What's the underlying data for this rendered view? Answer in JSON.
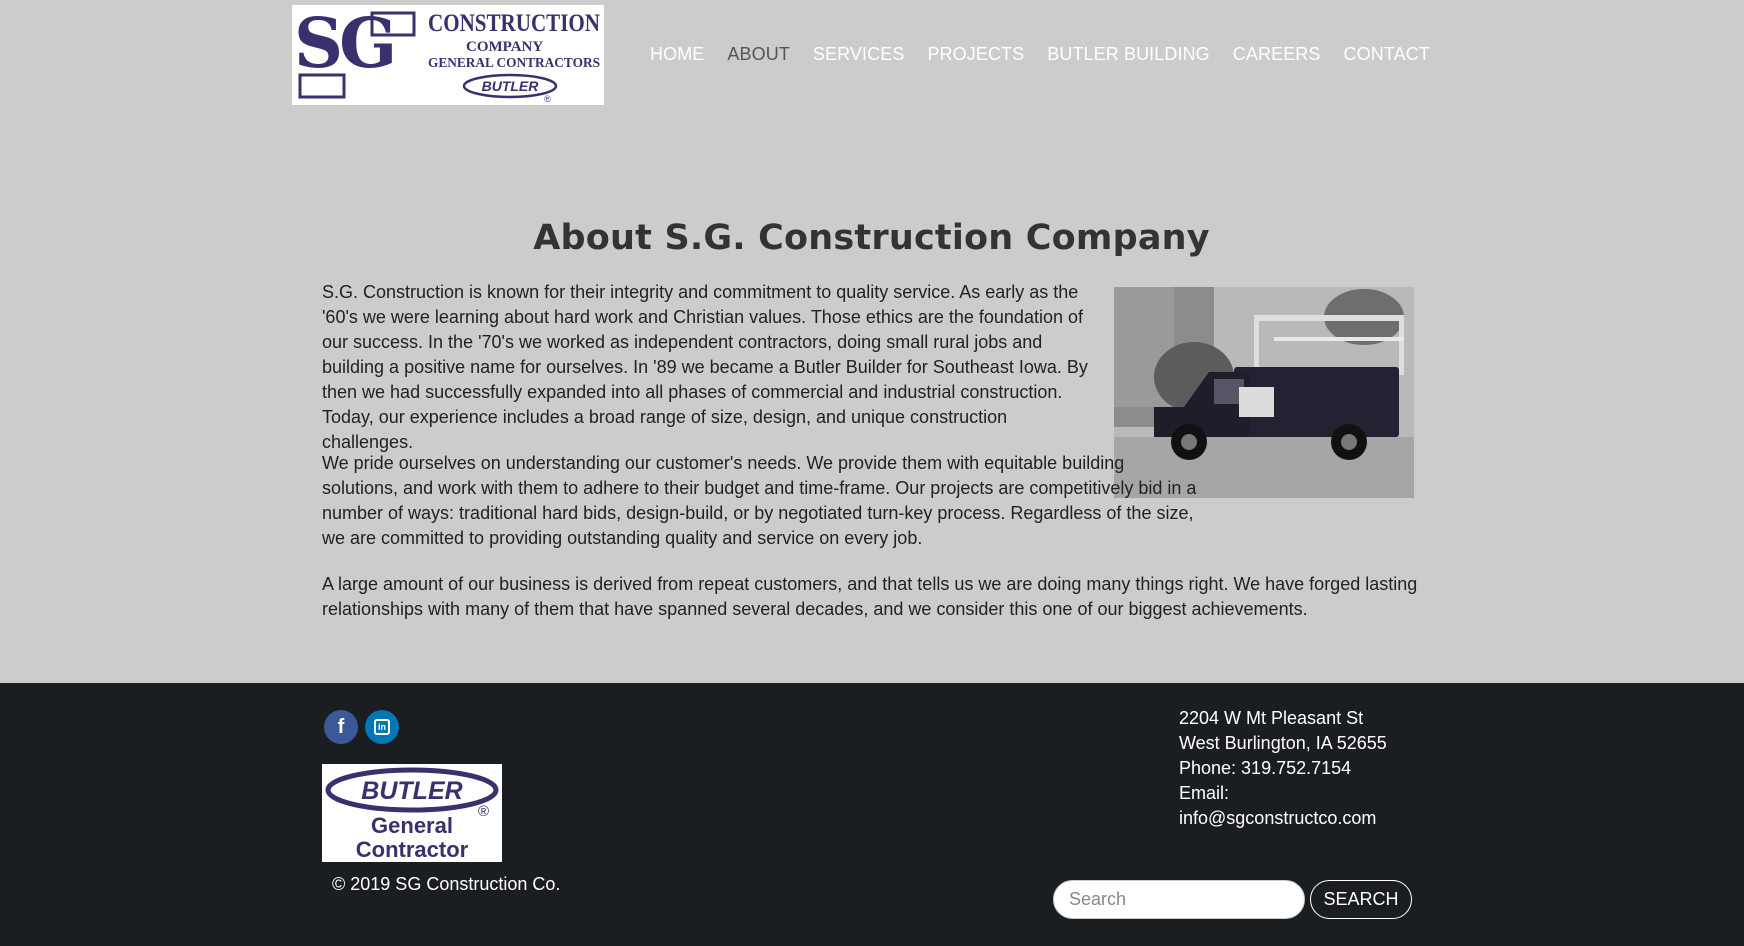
{
  "header": {
    "logo": {
      "alt": "SG Construction Company General Contractors Butler",
      "letters": "SG",
      "line1": "CONSTRUCTION",
      "line2": "COMPANY",
      "line3": "GENERAL CONTRACTORS",
      "badge": "BUTLER",
      "registered": "®",
      "color": "#3b2f6e"
    },
    "nav": [
      {
        "label": "HOME",
        "active": false
      },
      {
        "label": "ABOUT",
        "active": true
      },
      {
        "label": "SERVICES",
        "active": false
      },
      {
        "label": "PROJECTS",
        "active": false
      },
      {
        "label": "BUTLER BUILDING",
        "active": false
      },
      {
        "label": "CAREERS",
        "active": false
      },
      {
        "label": "CONTACT",
        "active": false
      }
    ]
  },
  "main": {
    "title": "About S.G. Construction Company",
    "paragraphs": [
      "S.G. Construction is known for their integrity and commitment to quality service. As early as the '60's we were learning about hard work and Christian values. Those ethics are the foundation of our success. In the '70's we worked as independent contractors, doing small rural jobs and building a positive name for ourselves. In '89 we became a Butler Builder for Southeast Iowa. By then we had successfully expanded into all phases of commercial and industrial construction. Today, our experience includes a broad range of size, design, and unique construction challenges.",
      "We pride ourselves on understanding our customer's needs. We provide them with equitable building solutions, and work with them to adhere to their budget and time-frame. Our projects are competitively bid in a number of ways: traditional hard bids, design-build, or by negotiated turn-key process. Regardless of the size, we are committed to providing outstanding quality and service on every job.",
      "A large amount of our business is derived from repeat customers, and that tells us we are doing many things right. We have forged lasting relationships with many of them that have spanned several decades, and we consider this one of our biggest achievements."
    ]
  },
  "footer": {
    "social": [
      {
        "name": "facebook-icon",
        "glyph": "f",
        "color": "#3b5998"
      },
      {
        "name": "linkedin-icon",
        "glyph": "in",
        "color": "#0077b5"
      }
    ],
    "butler_badge": {
      "brand": "BUTLER",
      "registered": "®",
      "line1": "General",
      "line2": "Contractor"
    },
    "copyright": "© 2019 SG Construction Co.",
    "address": {
      "street": "2204 W Mt Pleasant St",
      "city": "West Burlington, IA 52655",
      "phone": "Phone: 319.752.7154",
      "email_label": "Email:",
      "email": "info@sgconstructco.com"
    },
    "search": {
      "placeholder": "Search",
      "value": "",
      "button_label": "SEARCH"
    }
  },
  "colors": {
    "page_bg": "#cccccc",
    "footer_bg": "#1b1e21",
    "brand_purple": "#3b2f6e",
    "nav_text": "#ffffff",
    "nav_active": "#555555"
  }
}
